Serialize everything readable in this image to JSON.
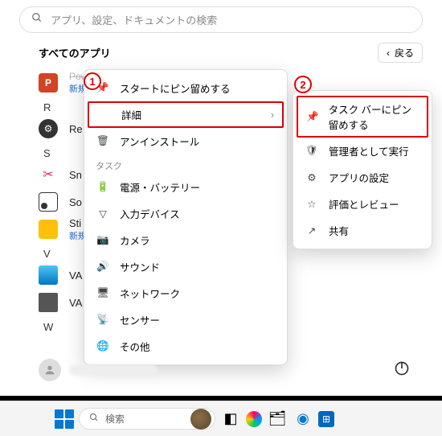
{
  "search": {
    "placeholder": "アプリ、設定、ドキュメントの検索"
  },
  "header": {
    "title": "すべてのアプリ",
    "back": "戻る"
  },
  "apps": {
    "pp_name": "PowerPoint",
    "pp_sub": "新規",
    "letter_r": "R",
    "re": "Re",
    "letter_s": "S",
    "sn": "Sn",
    "so": "So",
    "st": "Sti",
    "st_sub": "新規",
    "letter_v": "V",
    "va1": "VA",
    "va2": "VA",
    "letter_w": "W"
  },
  "ctx1": {
    "pin_start": "スタートにピン留めする",
    "details": "詳細",
    "uninstall": "アンインストール",
    "task_header": "タスク",
    "battery": "電源・バッテリー",
    "input": "入力デバイス",
    "camera": "カメラ",
    "sound": "サウンド",
    "network": "ネットワーク",
    "sensor": "センサー",
    "other": "その他"
  },
  "ctx2": {
    "pin_taskbar": "タスク バーにピン留めする",
    "run_admin": "管理者として実行",
    "app_settings": "アプリの設定",
    "review": "評価とレビュー",
    "share": "共有"
  },
  "callouts": {
    "one": "1",
    "two": "2"
  },
  "taskbar": {
    "search": "検索"
  }
}
